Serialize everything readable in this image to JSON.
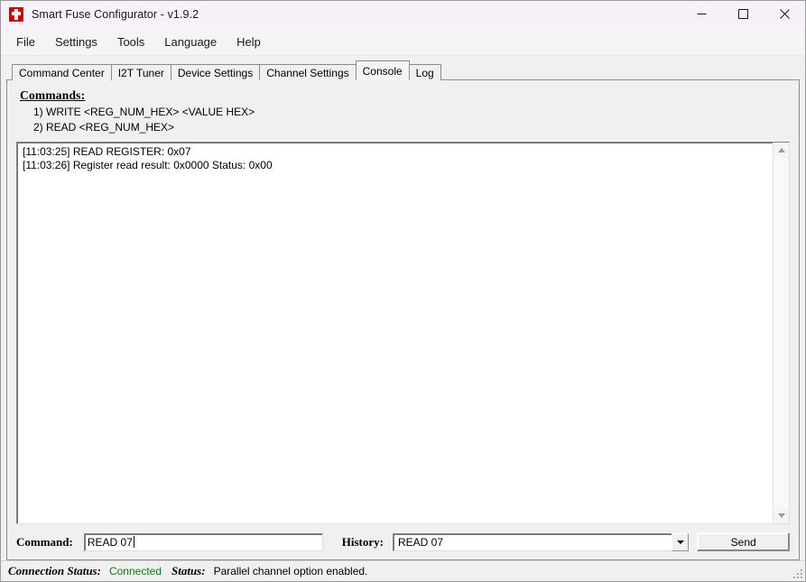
{
  "window": {
    "title": "Smart Fuse Configurator - v1.9.2",
    "icon": "ti-logo-icon",
    "controls": {
      "minimize": "minimize-icon",
      "maximize": "maximize-icon",
      "close": "close-icon"
    },
    "colors": {
      "titlebar_bg": "#f6f0f8",
      "icon_red": "#cc0000",
      "face": "#f0f0f0",
      "connected_green": "#12771b"
    }
  },
  "menubar": {
    "items": [
      {
        "label": "File"
      },
      {
        "label": "Settings"
      },
      {
        "label": "Tools"
      },
      {
        "label": "Language"
      },
      {
        "label": "Help"
      }
    ]
  },
  "tabs": {
    "active_index": 4,
    "items": [
      {
        "label": "Command Center"
      },
      {
        "label": "I2T Tuner"
      },
      {
        "label": "Device Settings"
      },
      {
        "label": "Channel Settings"
      },
      {
        "label": "Console"
      },
      {
        "label": "Log"
      }
    ]
  },
  "console_tab": {
    "commands_heading": "Commands:",
    "command_syntax": [
      "1) WRITE <REG_NUM_HEX> <VALUE HEX>",
      "2) READ <REG_NUM_HEX>"
    ],
    "log_lines": [
      "[11:03:25] READ REGISTER: 0x07",
      "[11:03:26] Register read result: 0x0000 Status: 0x00"
    ],
    "log_text": "[11:03:25] READ REGISTER: 0x07\n[11:03:26] Register read result: 0x0000 Status: 0x00",
    "scrollbar": {
      "up_arrow": "scroll-up-icon",
      "down_arrow": "scroll-down-icon"
    },
    "command_label": "Command:",
    "command_value": "READ 07",
    "command_placeholder": "",
    "history_label": "History:",
    "history_value": "READ 07",
    "history_options": [
      "READ 07"
    ],
    "history_arrow": "chevron-down-icon",
    "send_label": "Send"
  },
  "statusbar": {
    "connection_label": "Connection Status:",
    "connection_value": "Connected",
    "status_label": "Status:",
    "status_value": "Parallel channel option enabled.",
    "resize_grip": "resize-grip-icon"
  }
}
